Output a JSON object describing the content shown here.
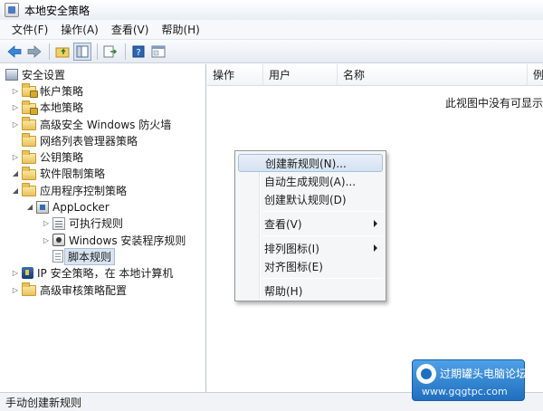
{
  "window": {
    "title": "本地安全策略"
  },
  "menubar": [
    "文件(F)",
    "操作(A)",
    "查看(V)",
    "帮助(H)"
  ],
  "toolbar": {
    "buttons": [
      "back-arrow-icon",
      "forward-arrow-icon",
      "up-folder-icon",
      "show-hide-tree-icon",
      "export-list-icon",
      "help-icon",
      "properties-icon"
    ]
  },
  "tree": {
    "root": "安全设置",
    "items": [
      {
        "label": "帐户策略",
        "level": 1,
        "expander": "collapsed",
        "icon": "lock-folder"
      },
      {
        "label": "本地策略",
        "level": 1,
        "expander": "collapsed",
        "icon": "lock-folder"
      },
      {
        "label": "高级安全 Windows 防火墙",
        "level": 1,
        "expander": "collapsed",
        "icon": "folder"
      },
      {
        "label": "网络列表管理器策略",
        "level": 1,
        "expander": "none",
        "icon": "folder"
      },
      {
        "label": "公钥策略",
        "level": 1,
        "expander": "collapsed",
        "icon": "folder"
      },
      {
        "label": "软件限制策略",
        "level": 1,
        "expander": "expanded",
        "icon": "folder"
      },
      {
        "label": "应用程序控制策略",
        "level": 1,
        "expander": "expanded",
        "icon": "folder"
      },
      {
        "label": "AppLocker",
        "level": 2,
        "expander": "expanded",
        "icon": "applocker"
      },
      {
        "label": "可执行规则",
        "level": 3,
        "expander": "collapsed",
        "icon": "rules"
      },
      {
        "label": "Windows 安装程序规则",
        "level": 3,
        "expander": "collapsed",
        "icon": "installer"
      },
      {
        "label": "脚本规则",
        "level": 3,
        "expander": "none",
        "icon": "script",
        "selected": true
      },
      {
        "label": "IP 安全策略，在 本地计算机",
        "level": 1,
        "expander": "collapsed",
        "icon": "ipsec"
      },
      {
        "label": "高级审核策略配置",
        "level": 1,
        "expander": "collapsed",
        "icon": "folder"
      }
    ]
  },
  "list": {
    "columns": [
      "操作",
      "用户",
      "名称",
      "例"
    ],
    "empty_message": "此视图中没有可显示"
  },
  "context_menu": {
    "items": [
      {
        "label": "创建新规则(N)...",
        "highlighted": true
      },
      {
        "label": "自动生成规则(A)..."
      },
      {
        "label": "创建默认规则(D)"
      },
      {
        "separator": true
      },
      {
        "label": "查看(V)",
        "submenu": true
      },
      {
        "separator": true
      },
      {
        "label": "排列图标(I)",
        "submenu": true
      },
      {
        "label": "对齐图标(E)"
      },
      {
        "separator": true
      },
      {
        "label": "帮助(H)"
      }
    ]
  },
  "statusbar": {
    "text": "手动创建新规则"
  },
  "watermark": {
    "title": "过期罐头电脑论坛",
    "url": "www.gqgtpc.com"
  },
  "colors": {
    "selection": "#d9e4f1",
    "menu_highlight": "#d5e2f2",
    "watermark": "#2f86d6"
  }
}
